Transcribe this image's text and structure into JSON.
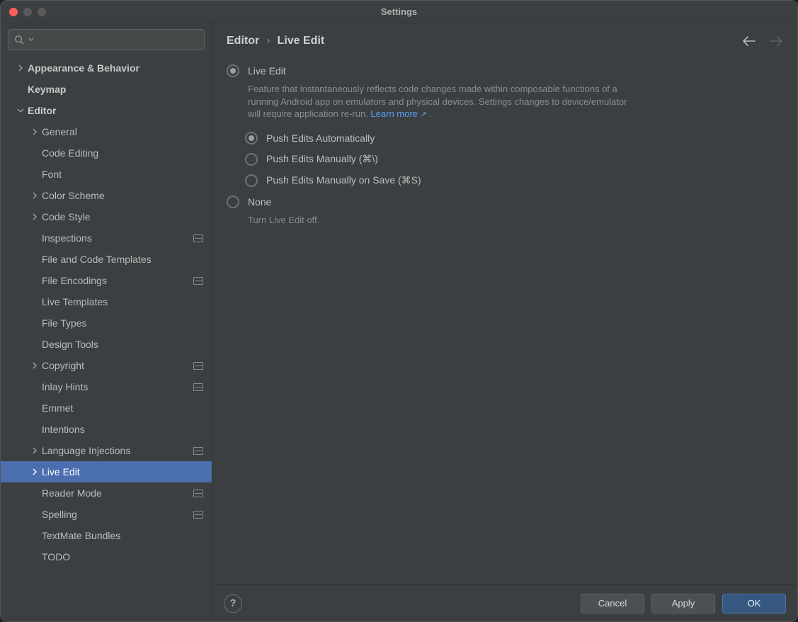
{
  "window": {
    "title": "Settings"
  },
  "search": {
    "placeholder": ""
  },
  "sidebar": {
    "items": [
      {
        "label": "Appearance & Behavior",
        "level": 0,
        "bold": true,
        "chevron": "right"
      },
      {
        "label": "Keymap",
        "level": 0,
        "bold": true
      },
      {
        "label": "Editor",
        "level": 0,
        "bold": true,
        "chevron": "down"
      },
      {
        "label": "General",
        "level": 1,
        "chevron": "right"
      },
      {
        "label": "Code Editing",
        "level": 1
      },
      {
        "label": "Font",
        "level": 1
      },
      {
        "label": "Color Scheme",
        "level": 1,
        "chevron": "right"
      },
      {
        "label": "Code Style",
        "level": 1,
        "chevron": "right"
      },
      {
        "label": "Inspections",
        "level": 1,
        "projectIcon": true
      },
      {
        "label": "File and Code Templates",
        "level": 1
      },
      {
        "label": "File Encodings",
        "level": 1,
        "projectIcon": true
      },
      {
        "label": "Live Templates",
        "level": 1
      },
      {
        "label": "File Types",
        "level": 1
      },
      {
        "label": "Design Tools",
        "level": 1
      },
      {
        "label": "Copyright",
        "level": 1,
        "chevron": "right",
        "projectIcon": true
      },
      {
        "label": "Inlay Hints",
        "level": 1,
        "projectIcon": true
      },
      {
        "label": "Emmet",
        "level": 1
      },
      {
        "label": "Intentions",
        "level": 1
      },
      {
        "label": "Language Injections",
        "level": 1,
        "chevron": "right",
        "projectIcon": true
      },
      {
        "label": "Live Edit",
        "level": 1,
        "chevron": "right",
        "selected": true
      },
      {
        "label": "Reader Mode",
        "level": 1,
        "projectIcon": true
      },
      {
        "label": "Spelling",
        "level": 1,
        "projectIcon": true
      },
      {
        "label": "TextMate Bundles",
        "level": 1
      },
      {
        "label": "TODO",
        "level": 1
      }
    ]
  },
  "breadcrumb": {
    "a": "Editor",
    "sep": "›",
    "b": "Live Edit"
  },
  "content": {
    "liveEdit": {
      "label": "Live Edit",
      "desc_a": "Feature that instantaneously reflects code changes made within composable functions of a running Android app on emulators and physical devices. Settings changes to device/emulator will require application re-run. ",
      "learn": "Learn more",
      "desc_b": " ."
    },
    "pushAuto": {
      "label": "Push Edits Automatically"
    },
    "pushManual": {
      "label": "Push Edits Manually (⌘\\)"
    },
    "pushSave": {
      "label": "Push Edits Manually on Save (⌘S)"
    },
    "none": {
      "label": "None",
      "desc": "Turn Live Edit off."
    }
  },
  "footer": {
    "cancel": "Cancel",
    "apply": "Apply",
    "ok": "OK"
  }
}
